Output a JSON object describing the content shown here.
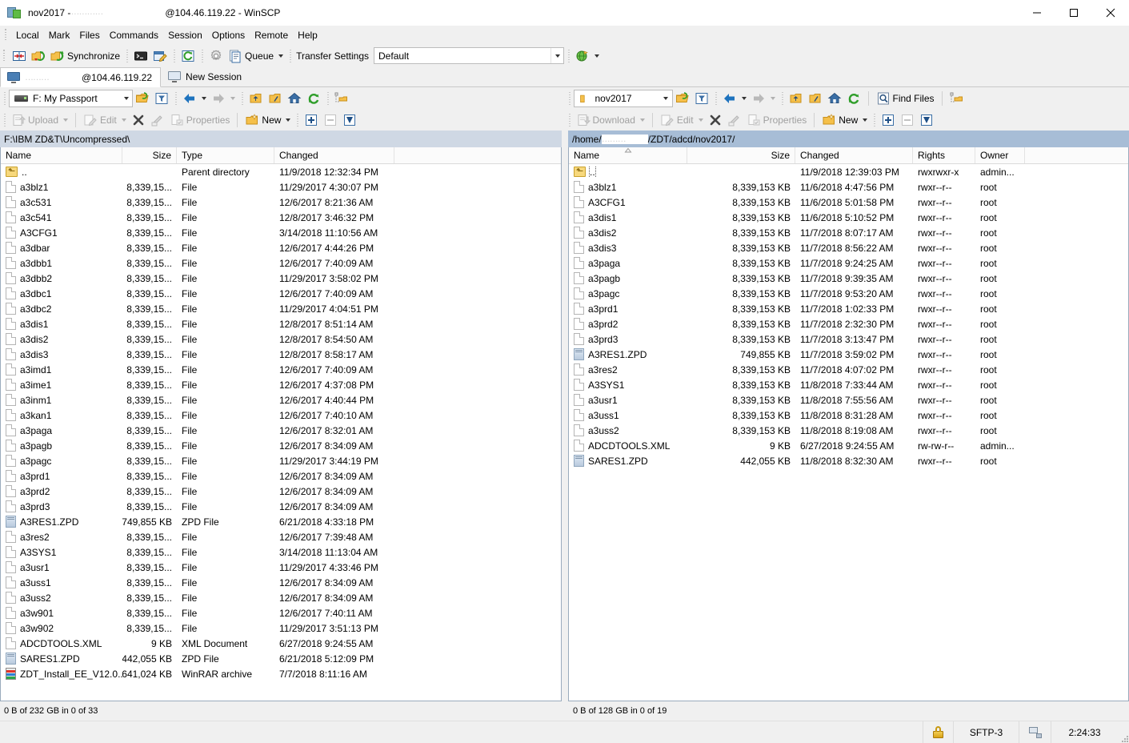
{
  "window": {
    "title_prefix": "nov2017 - ",
    "title_redacted": "…………",
    "title_suffix": "@104.46.119.22 - WinSCP",
    "minimize_label": "Minimize",
    "maximize_label": "Maximize",
    "close_label": "Close"
  },
  "menubar": {
    "items": [
      {
        "label": "Local"
      },
      {
        "label": "Mark"
      },
      {
        "label": "Files"
      },
      {
        "label": "Commands"
      },
      {
        "label": "Session"
      },
      {
        "label": "Options"
      },
      {
        "label": "Remote"
      },
      {
        "label": "Help"
      }
    ]
  },
  "main_toolbar": {
    "synchronize_label": "Synchronize",
    "queue_label": "Queue",
    "transfer_settings_label": "Transfer Settings",
    "transfer_settings_value": "Default",
    "icons": {
      "sync_browsing": "sync-browsing-icon",
      "synchronize_pair": "synchronize-pair-icon",
      "synchronize": "synchronize-icon",
      "console": "console-icon",
      "keep_remote_up_to_date": "keep-remote-up-to-date-icon",
      "refresh": "refresh-icon",
      "preferences": "preferences-gear-icon",
      "queue": "queue-icon",
      "transfer_globe": "transfer-globe-icon"
    }
  },
  "tabs": {
    "session_tab_redacted": "………",
    "session_tab_label": "@104.46.119.22",
    "new_session_label": "New Session"
  },
  "left_panel": {
    "drive_value": "F: My Passport",
    "path": "F:\\IBM ZD&T\\Uncompressed\\",
    "toolbar": {
      "upload_label": "Upload",
      "edit_label": "Edit",
      "delete_label": "Delete",
      "rename_label": "Rename",
      "properties_label": "Properties",
      "new_label": "New"
    },
    "columns": [
      "Name",
      "Size",
      "Type",
      "Changed"
    ],
    "status": "0 B of 232 GB in 0 of 33",
    "rows": [
      {
        "icon": "up",
        "name": "..",
        "size": "",
        "type": "Parent directory",
        "changed": "11/9/2018  12:32:34 PM"
      },
      {
        "icon": "doc",
        "name": "a3blz1",
        "size": "8,339,15...",
        "type": "File",
        "changed": "11/29/2017  4:30:07 PM"
      },
      {
        "icon": "doc",
        "name": "a3c531",
        "size": "8,339,15...",
        "type": "File",
        "changed": "12/6/2017  8:21:36 AM"
      },
      {
        "icon": "doc",
        "name": "a3c541",
        "size": "8,339,15...",
        "type": "File",
        "changed": "12/8/2017  3:46:32 PM"
      },
      {
        "icon": "doc",
        "name": "A3CFG1",
        "size": "8,339,15...",
        "type": "File",
        "changed": "3/14/2018  11:10:56 AM"
      },
      {
        "icon": "doc",
        "name": "a3dbar",
        "size": "8,339,15...",
        "type": "File",
        "changed": "12/6/2017  4:44:26 PM"
      },
      {
        "icon": "doc",
        "name": "a3dbb1",
        "size": "8,339,15...",
        "type": "File",
        "changed": "12/6/2017  7:40:09 AM"
      },
      {
        "icon": "doc",
        "name": "a3dbb2",
        "size": "8,339,15...",
        "type": "File",
        "changed": "11/29/2017  3:58:02 PM"
      },
      {
        "icon": "doc",
        "name": "a3dbc1",
        "size": "8,339,15...",
        "type": "File",
        "changed": "12/6/2017  7:40:09 AM"
      },
      {
        "icon": "doc",
        "name": "a3dbc2",
        "size": "8,339,15...",
        "type": "File",
        "changed": "11/29/2017  4:04:51 PM"
      },
      {
        "icon": "doc",
        "name": "a3dis1",
        "size": "8,339,15...",
        "type": "File",
        "changed": "12/8/2017  8:51:14 AM"
      },
      {
        "icon": "doc",
        "name": "a3dis2",
        "size": "8,339,15...",
        "type": "File",
        "changed": "12/8/2017  8:54:50 AM"
      },
      {
        "icon": "doc",
        "name": "a3dis3",
        "size": "8,339,15...",
        "type": "File",
        "changed": "12/8/2017  8:58:17 AM"
      },
      {
        "icon": "doc",
        "name": "a3imd1",
        "size": "8,339,15...",
        "type": "File",
        "changed": "12/6/2017  7:40:09 AM"
      },
      {
        "icon": "doc",
        "name": "a3ime1",
        "size": "8,339,15...",
        "type": "File",
        "changed": "12/6/2017  4:37:08 PM"
      },
      {
        "icon": "doc",
        "name": "a3inm1",
        "size": "8,339,15...",
        "type": "File",
        "changed": "12/6/2017  4:40:44 PM"
      },
      {
        "icon": "doc",
        "name": "a3kan1",
        "size": "8,339,15...",
        "type": "File",
        "changed": "12/6/2017  7:40:10 AM"
      },
      {
        "icon": "doc",
        "name": "a3paga",
        "size": "8,339,15...",
        "type": "File",
        "changed": "12/6/2017  8:32:01 AM"
      },
      {
        "icon": "doc",
        "name": "a3pagb",
        "size": "8,339,15...",
        "type": "File",
        "changed": "12/6/2017  8:34:09 AM"
      },
      {
        "icon": "doc",
        "name": "a3pagc",
        "size": "8,339,15...",
        "type": "File",
        "changed": "11/29/2017  3:44:19 PM"
      },
      {
        "icon": "doc",
        "name": "a3prd1",
        "size": "8,339,15...",
        "type": "File",
        "changed": "12/6/2017  8:34:09 AM"
      },
      {
        "icon": "doc",
        "name": "a3prd2",
        "size": "8,339,15...",
        "type": "File",
        "changed": "12/6/2017  8:34:09 AM"
      },
      {
        "icon": "doc",
        "name": "a3prd3",
        "size": "8,339,15...",
        "type": "File",
        "changed": "12/6/2017  8:34:09 AM"
      },
      {
        "icon": "zpd",
        "name": "A3RES1.ZPD",
        "size": "749,855 KB",
        "type": "ZPD File",
        "changed": "6/21/2018  4:33:18 PM"
      },
      {
        "icon": "doc",
        "name": "a3res2",
        "size": "8,339,15...",
        "type": "File",
        "changed": "12/6/2017  7:39:48 AM"
      },
      {
        "icon": "doc",
        "name": "A3SYS1",
        "size": "8,339,15...",
        "type": "File",
        "changed": "3/14/2018  11:13:04 AM"
      },
      {
        "icon": "doc",
        "name": "a3usr1",
        "size": "8,339,15...",
        "type": "File",
        "changed": "11/29/2017  4:33:46 PM"
      },
      {
        "icon": "doc",
        "name": "a3uss1",
        "size": "8,339,15...",
        "type": "File",
        "changed": "12/6/2017  8:34:09 AM"
      },
      {
        "icon": "doc",
        "name": "a3uss2",
        "size": "8,339,15...",
        "type": "File",
        "changed": "12/6/2017  8:34:09 AM"
      },
      {
        "icon": "doc",
        "name": "a3w901",
        "size": "8,339,15...",
        "type": "File",
        "changed": "12/6/2017  7:40:11 AM"
      },
      {
        "icon": "doc",
        "name": "a3w902",
        "size": "8,339,15...",
        "type": "File",
        "changed": "11/29/2017  3:51:13 PM"
      },
      {
        "icon": "doc",
        "name": "ADCDTOOLS.XML",
        "size": "9 KB",
        "type": "XML Document",
        "changed": "6/27/2018  9:24:55 AM"
      },
      {
        "icon": "zpd",
        "name": "SARES1.ZPD",
        "size": "442,055 KB",
        "type": "ZPD File",
        "changed": "6/21/2018  5:12:09 PM"
      },
      {
        "icon": "rar",
        "name": "ZDT_Install_EE_V12.0....",
        "size": "641,024 KB",
        "type": "WinRAR archive",
        "changed": "7/7/2018  8:11:16 AM"
      }
    ]
  },
  "right_panel": {
    "dir_value": "nov2017",
    "path_prefix": "/home/",
    "path_redacted": "………",
    "path_suffix": "/ZDT/adcd/nov2017/",
    "find_files_label": "Find Files",
    "toolbar": {
      "download_label": "Download",
      "edit_label": "Edit",
      "delete_label": "Delete",
      "rename_label": "Rename",
      "properties_label": "Properties",
      "new_label": "New"
    },
    "columns": [
      "Name",
      "Size",
      "Changed",
      "Rights",
      "Owner"
    ],
    "status": "0 B of 128 GB in 0 of 19",
    "rows": [
      {
        "icon": "up",
        "name": "..",
        "size": "",
        "changed": "11/9/2018 12:39:03 PM",
        "rights": "rwxrwxr-x",
        "owner": "admin...",
        "selected": true
      },
      {
        "icon": "doc",
        "name": "a3blz1",
        "size": "8,339,153 KB",
        "changed": "11/6/2018 4:47:56 PM",
        "rights": "rwxr--r--",
        "owner": "root"
      },
      {
        "icon": "doc",
        "name": "A3CFG1",
        "size": "8,339,153 KB",
        "changed": "11/6/2018 5:01:58 PM",
        "rights": "rwxr--r--",
        "owner": "root"
      },
      {
        "icon": "doc",
        "name": "a3dis1",
        "size": "8,339,153 KB",
        "changed": "11/6/2018 5:10:52 PM",
        "rights": "rwxr--r--",
        "owner": "root"
      },
      {
        "icon": "doc",
        "name": "a3dis2",
        "size": "8,339,153 KB",
        "changed": "11/7/2018 8:07:17 AM",
        "rights": "rwxr--r--",
        "owner": "root"
      },
      {
        "icon": "doc",
        "name": "a3dis3",
        "size": "8,339,153 KB",
        "changed": "11/7/2018 8:56:22 AM",
        "rights": "rwxr--r--",
        "owner": "root"
      },
      {
        "icon": "doc",
        "name": "a3paga",
        "size": "8,339,153 KB",
        "changed": "11/7/2018 9:24:25 AM",
        "rights": "rwxr--r--",
        "owner": "root"
      },
      {
        "icon": "doc",
        "name": "a3pagb",
        "size": "8,339,153 KB",
        "changed": "11/7/2018 9:39:35 AM",
        "rights": "rwxr--r--",
        "owner": "root"
      },
      {
        "icon": "doc",
        "name": "a3pagc",
        "size": "8,339,153 KB",
        "changed": "11/7/2018 9:53:20 AM",
        "rights": "rwxr--r--",
        "owner": "root"
      },
      {
        "icon": "doc",
        "name": "a3prd1",
        "size": "8,339,153 KB",
        "changed": "11/7/2018 1:02:33 PM",
        "rights": "rwxr--r--",
        "owner": "root"
      },
      {
        "icon": "doc",
        "name": "a3prd2",
        "size": "8,339,153 KB",
        "changed": "11/7/2018 2:32:30 PM",
        "rights": "rwxr--r--",
        "owner": "root"
      },
      {
        "icon": "doc",
        "name": "a3prd3",
        "size": "8,339,153 KB",
        "changed": "11/7/2018 3:13:47 PM",
        "rights": "rwxr--r--",
        "owner": "root"
      },
      {
        "icon": "zpd",
        "name": "A3RES1.ZPD",
        "size": "749,855 KB",
        "changed": "11/7/2018 3:59:02 PM",
        "rights": "rwxr--r--",
        "owner": "root"
      },
      {
        "icon": "doc",
        "name": "a3res2",
        "size": "8,339,153 KB",
        "changed": "11/7/2018 4:07:02 PM",
        "rights": "rwxr--r--",
        "owner": "root"
      },
      {
        "icon": "doc",
        "name": "A3SYS1",
        "size": "8,339,153 KB",
        "changed": "11/8/2018 7:33:44 AM",
        "rights": "rwxr--r--",
        "owner": "root"
      },
      {
        "icon": "doc",
        "name": "a3usr1",
        "size": "8,339,153 KB",
        "changed": "11/8/2018 7:55:56 AM",
        "rights": "rwxr--r--",
        "owner": "root"
      },
      {
        "icon": "doc",
        "name": "a3uss1",
        "size": "8,339,153 KB",
        "changed": "11/8/2018 8:31:28 AM",
        "rights": "rwxr--r--",
        "owner": "root"
      },
      {
        "icon": "doc",
        "name": "a3uss2",
        "size": "8,339,153 KB",
        "changed": "11/8/2018 8:19:08 AM",
        "rights": "rwxr--r--",
        "owner": "root"
      },
      {
        "icon": "doc",
        "name": "ADCDTOOLS.XML",
        "size": "9 KB",
        "changed": "6/27/2018 9:24:55 AM",
        "rights": "rw-rw-r--",
        "owner": "admin..."
      },
      {
        "icon": "zpd",
        "name": "SARES1.ZPD",
        "size": "442,055 KB",
        "changed": "11/8/2018 8:32:30 AM",
        "rights": "rwxr--r--",
        "owner": "root"
      }
    ]
  },
  "statusbar": {
    "protocol": "SFTP-3",
    "elapsed": "2:24:33",
    "lock_icon": "lock-icon",
    "net_icon": "network-icon"
  },
  "colors": {
    "path_active": "#a7bdd6",
    "path_inactive": "#cfd8e4",
    "panel_border": "#9aabbd",
    "chrome": "#f0f0f0"
  }
}
